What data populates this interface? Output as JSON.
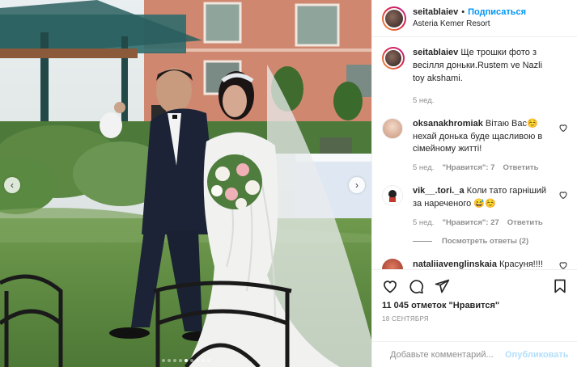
{
  "header": {
    "username": "seitablaiev",
    "separator": "•",
    "follow_label": "Подписаться",
    "location": "Asteria Kemer Resort",
    "avatar_icon": "profile-avatar"
  },
  "caption": {
    "username": "seitablaiev",
    "text": "Ще трошки фото з весілля доньки.Rustem ve Nazli toy akshami.",
    "time": "5 нед."
  },
  "comments": [
    {
      "username": "oksanakhromiak",
      "text": "Вітаю Вас☺️ нехай донька буде щасливою в сімейному житті!",
      "time": "5 нед.",
      "likes_label": "\"Нравится\": 7",
      "reply_label": "Ответить",
      "avatar_color": "#e9c7b5"
    },
    {
      "username": "vik__.tori._a",
      "text": "Коли тато гарніший за нареченого 😅☺️",
      "time": "5 нед.",
      "likes_label": "\"Нравится\": 27",
      "reply_label": "Ответить",
      "avatar_color": "#ffffff"
    },
    {
      "username": "nataliiavenglinskaia",
      "text": "Красуня!!!!",
      "time": "",
      "likes_label": "",
      "reply_label": "",
      "avatar_color": "#c0392b"
    }
  ],
  "view_replies_label": "Посмотреть ответы (2)",
  "likes_text": "11 045 отметок \"Нравится\"",
  "date_text": "18 СЕНТЯБРЯ",
  "add_comment": {
    "placeholder": "Добавьте комментарий...",
    "publish_label": "Опубликовать"
  },
  "carousel": {
    "total_dots": 9,
    "active_index": 4
  },
  "colors": {
    "accent": "#0095f6",
    "publish_disabled": "#b2dffc",
    "muted": "#8e8e8e"
  }
}
